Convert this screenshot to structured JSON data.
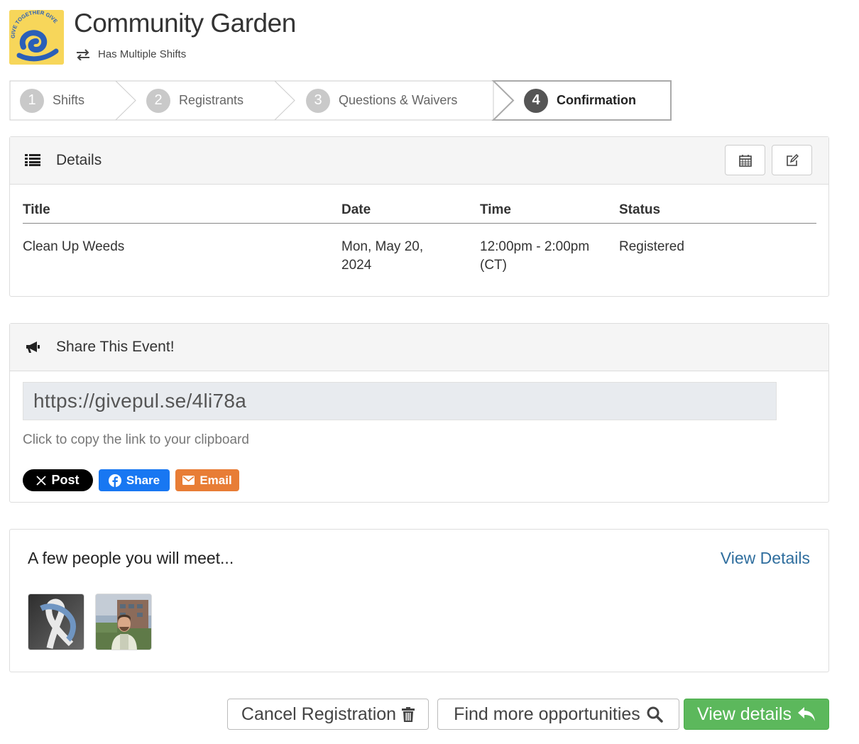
{
  "event": {
    "title": "Community Garden",
    "shift_note": "Has Multiple Shifts",
    "logo_text": "GIVE TOGETHER GIVE"
  },
  "stepper": {
    "steps": [
      {
        "num": "1",
        "label": "Shifts"
      },
      {
        "num": "2",
        "label": "Registrants"
      },
      {
        "num": "3",
        "label": "Questions & Waivers"
      },
      {
        "num": "4",
        "label": "Confirmation"
      }
    ],
    "active_index": 3
  },
  "details": {
    "heading": "Details",
    "columns": [
      "Title",
      "Date",
      "Time",
      "Status"
    ],
    "row": {
      "title": "Clean Up Weeds",
      "date_line1": "Mon, May 20,",
      "date_line2": "2024",
      "time_line1": "12:00pm - 2:00pm",
      "time_line2": "(CT)",
      "status": "Registered"
    },
    "tool_icons": [
      "calendar-icon",
      "edit-icon"
    ]
  },
  "share": {
    "heading": "Share This Event!",
    "link": "https://givepul.se/4li78a",
    "hint": "Click to copy the link to your clipboard",
    "x_label": "Post",
    "fb_label": "Share",
    "email_label": "Email"
  },
  "meet": {
    "heading": "A few people you will meet...",
    "view_link": "View Details"
  },
  "actions": {
    "cancel": "Cancel Registration",
    "find": "Find more opportunities",
    "view": "View details"
  },
  "colors": {
    "green": "#5cb85c",
    "link_blue": "#2f6e9e",
    "facebook": "#1877f2",
    "email": "#e87d36",
    "logo_yellow": "#f7d65a",
    "logo_blue": "#2a5fb8"
  }
}
